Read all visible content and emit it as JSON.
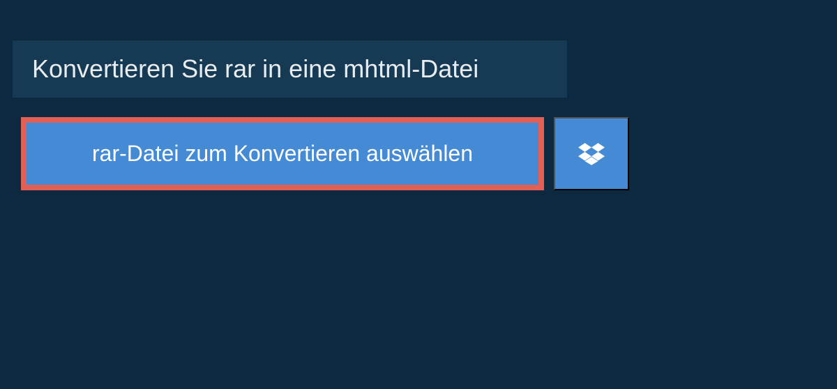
{
  "header": {
    "title": "Konvertieren Sie rar in eine mhtml-Datei"
  },
  "buttons": {
    "select_file_label": "rar-Datei zum Konvertieren auswählen"
  },
  "colors": {
    "background": "#0d2940",
    "header_bg": "#173a54",
    "button_bg": "#448ad4",
    "highlight_border": "#e15f54",
    "text_light": "#e8ecef",
    "text_white": "#ffffff"
  }
}
